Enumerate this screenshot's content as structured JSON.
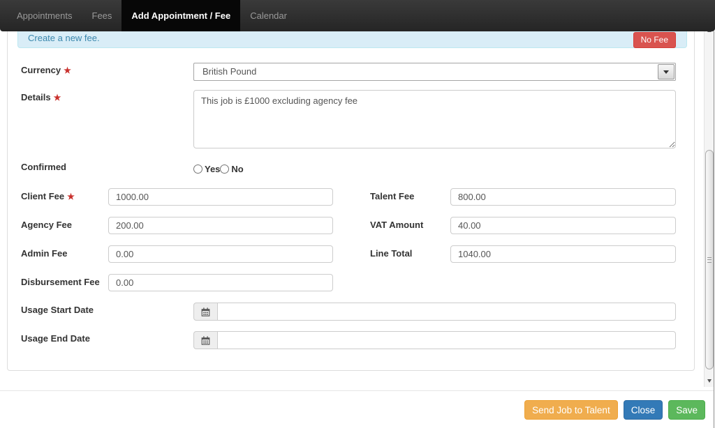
{
  "navbar": {
    "tabs": [
      {
        "label": "Appointments",
        "active": false
      },
      {
        "label": "Fees",
        "active": false
      },
      {
        "label": "Add Appointment / Fee",
        "active": true
      },
      {
        "label": "Calendar",
        "active": false
      }
    ]
  },
  "banner": {
    "message": "Create a new fee.",
    "no_fee_button": "No Fee"
  },
  "form": {
    "required_marker": "★",
    "currency": {
      "label": "Currency",
      "required": true,
      "value": "British Pound"
    },
    "details": {
      "label": "Details",
      "required": true,
      "value": "This job is £1000 excluding agency fee"
    },
    "confirmed": {
      "label": "Confirmed",
      "yes": "Yes",
      "no": "No",
      "yes_checked": false,
      "no_checked": false
    },
    "client_fee": {
      "label": "Client Fee",
      "required": true,
      "value": "1000.00"
    },
    "talent_fee": {
      "label": "Talent Fee",
      "value": "800.00"
    },
    "agency_fee": {
      "label": "Agency Fee",
      "value": "200.00"
    },
    "vat_amount": {
      "label": "VAT Amount",
      "value": "40.00"
    },
    "admin_fee": {
      "label": "Admin Fee",
      "value": "0.00"
    },
    "line_total": {
      "label": "Line Total",
      "value": "1040.00"
    },
    "disbursement_fee": {
      "label": "Disbursement Fee",
      "value": "0.00"
    },
    "usage_start_date": {
      "label": "Usage Start Date",
      "value": ""
    },
    "usage_end_date": {
      "label": "Usage End Date",
      "value": ""
    }
  },
  "footer": {
    "send_button": "Send Job to Talent",
    "close_button": "Close",
    "save_button": "Save"
  },
  "colors": {
    "danger": "#d9534f",
    "warning": "#f0ad4e",
    "primary": "#337ab7",
    "success": "#5cb85c",
    "info_bg": "#d9edf7",
    "info_text": "#3a87ad",
    "navbar_bg": "#2e2e2e",
    "active_tab_bg": "#070707"
  }
}
